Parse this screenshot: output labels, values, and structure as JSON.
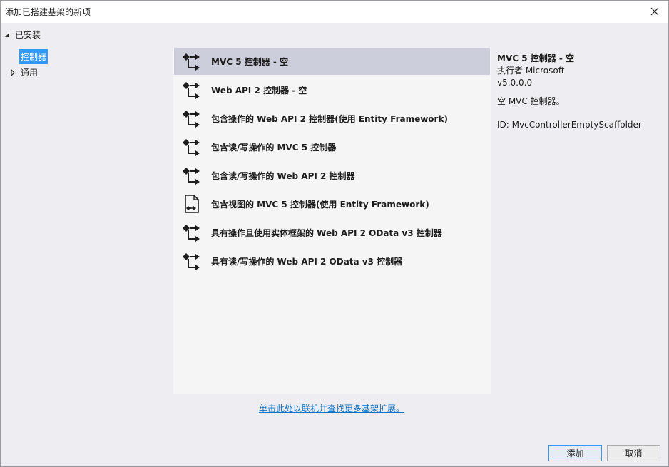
{
  "window": {
    "title": "添加已搭建基架的新项"
  },
  "tree": {
    "installed": "已安装",
    "controller": "控制器",
    "general": "通用"
  },
  "items": [
    {
      "label": "MVC 5 控制器 - 空",
      "icon": "controller-icon",
      "selected": true
    },
    {
      "label": "Web API 2 控制器 - 空",
      "icon": "controller-icon"
    },
    {
      "label": "包含操作的 Web API 2 控制器(使用 Entity Framework)",
      "icon": "controller-icon"
    },
    {
      "label": "包含读/写操作的 MVC 5 控制器",
      "icon": "controller-icon"
    },
    {
      "label": "包含读/写操作的 Web API 2 控制器",
      "icon": "controller-icon"
    },
    {
      "label": "包含视图的 MVC 5 控制器(使用 Entity Framework)",
      "icon": "view-controller-icon"
    },
    {
      "label": "具有操作且使用实体框架的 Web API 2 OData v3 控制器",
      "icon": "controller-icon"
    },
    {
      "label": "具有读/写操作的 Web API 2 OData v3 控制器",
      "icon": "controller-icon"
    }
  ],
  "details": {
    "title": "MVC 5 控制器 - 空",
    "author": "执行者 Microsoft",
    "version": "v5.0.0.0",
    "description": "空 MVC 控制器。",
    "id": "ID: MvcControllerEmptyScaffolder"
  },
  "online_link": "单击此处以联机并查找更多基架扩展。",
  "buttons": {
    "add": "添加",
    "cancel": "取消"
  },
  "colors": {
    "selection": "#cccedb",
    "tree_selection": "#3399ff",
    "link": "#0e70c0"
  }
}
